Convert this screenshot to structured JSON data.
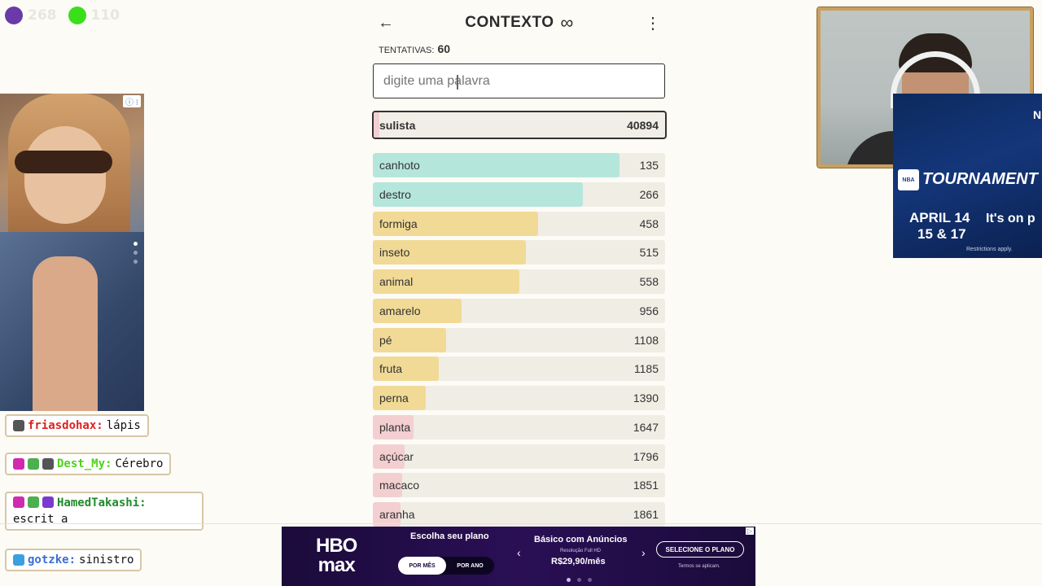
{
  "overlay": {
    "counters": [
      {
        "color": "#6a3aa8",
        "value": "268"
      },
      {
        "color": "#3adf1a",
        "value": "110"
      }
    ]
  },
  "left_ad": {
    "badge": "ⓘ ⁝"
  },
  "chat": [
    {
      "user": "friasdohax:",
      "text": "lápis",
      "user_color": "#d22",
      "badges": [
        "#555"
      ]
    },
    {
      "user": "Dest_My:",
      "text": "Cérebro",
      "user_color": "#4fd11a",
      "badges": [
        "#d02ab0",
        "#4caf50",
        "#555"
      ]
    },
    {
      "user": "HamedTakashi:",
      "text": "escrit a",
      "user_color": "#1f8a2a",
      "badges": [
        "#d02ab0",
        "#4caf50",
        "#7a3ad0"
      ]
    },
    {
      "user": "gotzke:",
      "text": "sinistro",
      "user_color": "#3a6fd6",
      "badges": [
        "#3aa0e0"
      ]
    }
  ],
  "game": {
    "title": "CONTEXTO",
    "title_icon": "∞",
    "attempts_label": "TENTATIVAS:",
    "attempts_value": "60",
    "search_placeholder": "digite uma palavra",
    "current_guess": {
      "word": "sulista",
      "rank": "40894"
    },
    "guesses": [
      {
        "word": "canhoto",
        "rank": "135",
        "fill": 0.845,
        "color": "#b5e6db"
      },
      {
        "word": "destro",
        "rank": "266",
        "fill": 0.72,
        "color": "#b5e6db"
      },
      {
        "word": "formiga",
        "rank": "458",
        "fill": 0.565,
        "color": "#f1da96"
      },
      {
        "word": "inseto",
        "rank": "515",
        "fill": 0.525,
        "color": "#f1da96"
      },
      {
        "word": "animal",
        "rank": "558",
        "fill": 0.5,
        "color": "#f1da96"
      },
      {
        "word": "amarelo",
        "rank": "956",
        "fill": 0.305,
        "color": "#f1da96"
      },
      {
        "word": "pé",
        "rank": "1108",
        "fill": 0.25,
        "color": "#f1da96"
      },
      {
        "word": "fruta",
        "rank": "1185",
        "fill": 0.225,
        "color": "#f1da96"
      },
      {
        "word": "perna",
        "rank": "1390",
        "fill": 0.18,
        "color": "#f1da96"
      },
      {
        "word": "planta",
        "rank": "1647",
        "fill": 0.14,
        "color": "#f3cfd1"
      },
      {
        "word": "açúcar",
        "rank": "1796",
        "fill": 0.11,
        "color": "#f3cfd1"
      },
      {
        "word": "macaco",
        "rank": "1851",
        "fill": 0.1,
        "color": "#f3cfd1"
      },
      {
        "word": "aranha",
        "rank": "1861",
        "fill": 0.095,
        "color": "#f3cfd1"
      }
    ]
  },
  "nba_ad": {
    "logo": "NBA",
    "title": "TOURNAMENT",
    "date_line1": "APRIL 14",
    "date_line2": "15 & 17",
    "tagline": "It's on p",
    "restrictions": "Restrictions apply.",
    "edge_letter": "N"
  },
  "hbo_ad": {
    "logo_line1": "HBO",
    "logo_line2": "max",
    "choose": "Escolha seu plano",
    "toggle_month": "POR MÊS",
    "toggle_year": "POR ANO",
    "plan_name": "Básico com Anúncios",
    "resolution": "Resolução Full HD",
    "price": "R$29,90/mês",
    "cta": "SELECIONE O PLANO",
    "terms": "Termos se aplicam."
  }
}
